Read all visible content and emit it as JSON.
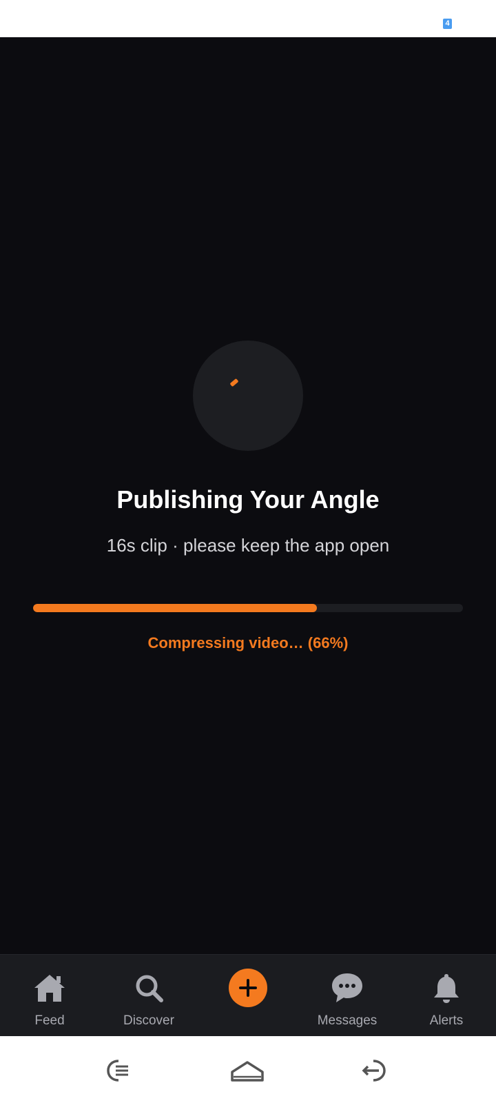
{
  "status_bar": {
    "notification_count": "4"
  },
  "upload": {
    "title": "Publishing Your Angle",
    "subtitle": "16s clip · please keep the app open",
    "progress_percent": 66,
    "status_text": "Compressing video… (66%)"
  },
  "tabs": [
    {
      "label": "Feed",
      "icon": "home-icon"
    },
    {
      "label": "Discover",
      "icon": "search-icon"
    },
    {
      "label": "",
      "icon": "plus-icon"
    },
    {
      "label": "Messages",
      "icon": "chat-icon"
    },
    {
      "label": "Alerts",
      "icon": "bell-icon"
    }
  ],
  "colors": {
    "accent": "#f47a1f",
    "background": "#0c0c10",
    "tabbar": "#1b1c20"
  },
  "system_nav": [
    "recents-icon",
    "home-icon",
    "back-icon"
  ]
}
